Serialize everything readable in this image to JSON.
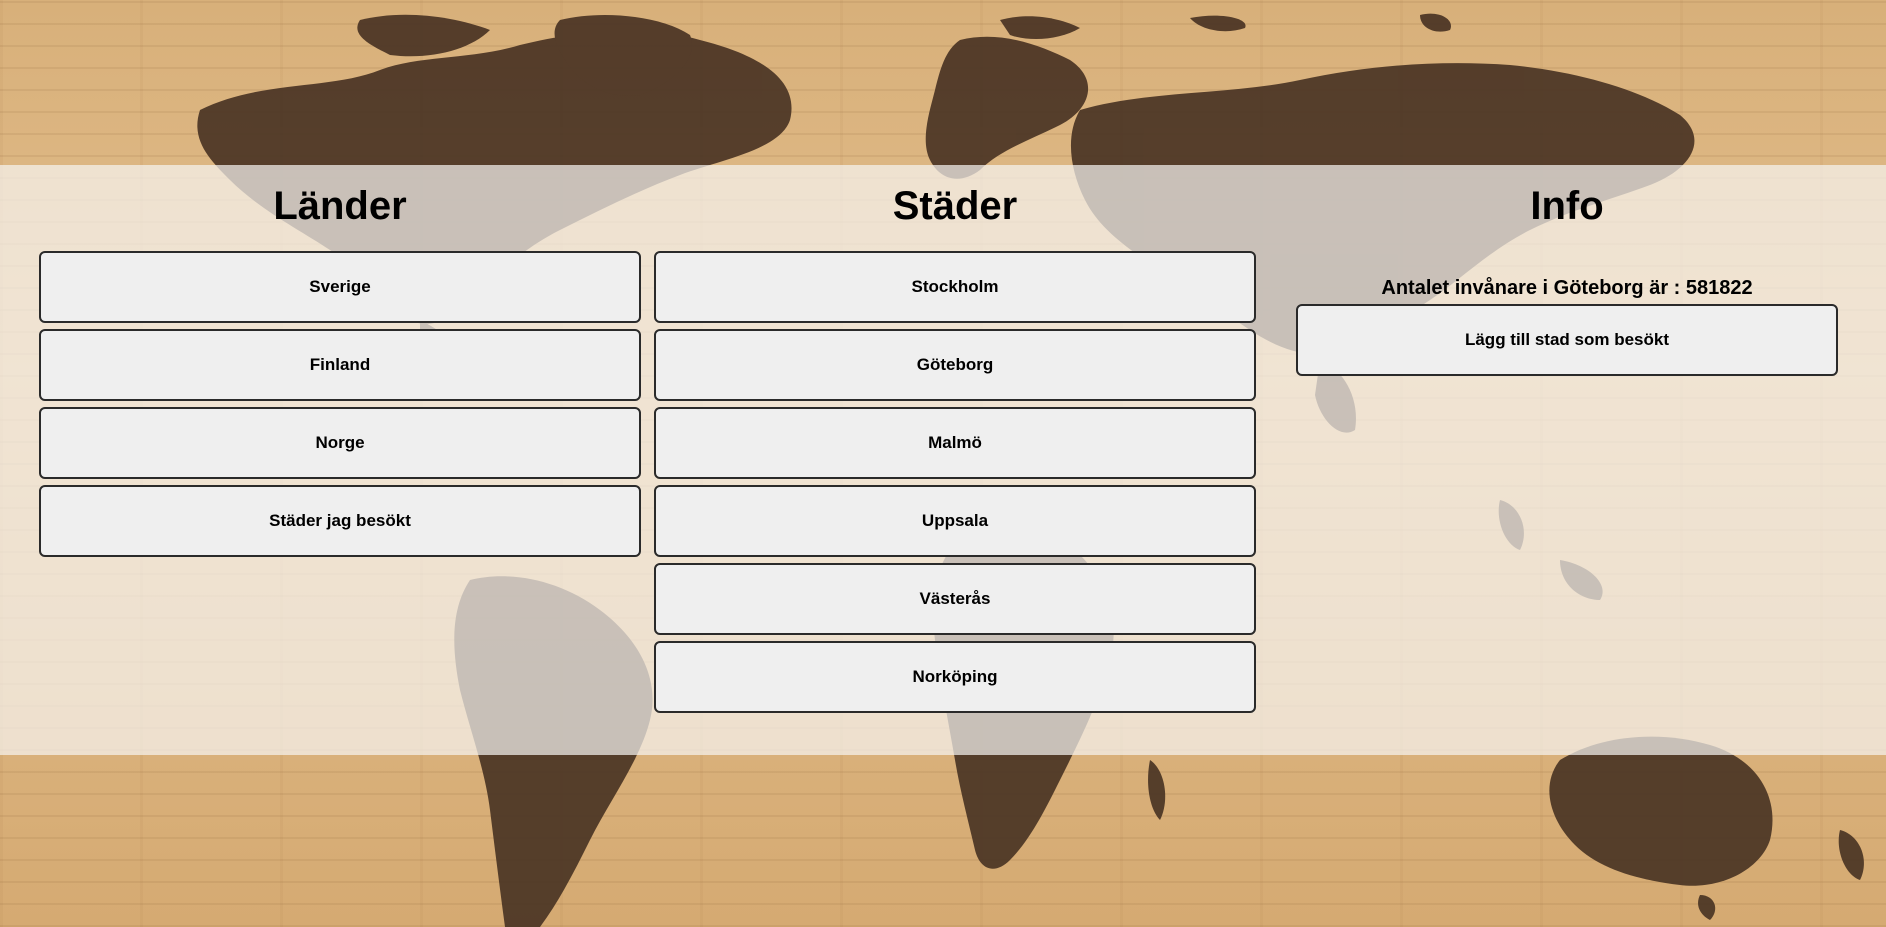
{
  "columns": {
    "lander": {
      "title": "Länder",
      "buttons": [
        "Sverige",
        "Finland",
        "Norge",
        "Städer jag besökt"
      ]
    },
    "stader": {
      "title": "Städer",
      "buttons": [
        "Stockholm",
        "Göteborg",
        "Malmö",
        "Uppsala",
        "Västerås",
        "Norköping"
      ]
    },
    "info": {
      "title": "Info",
      "text": "Antalet invånare i Göteborg är : 581822",
      "button": "Lägg till stad som besökt"
    }
  },
  "colors": {
    "panel": "#f5f2ee",
    "button_bg": "#efefef",
    "button_border": "#2a2a2a",
    "wood": "#d8b07a",
    "continent": "#4a3424"
  }
}
